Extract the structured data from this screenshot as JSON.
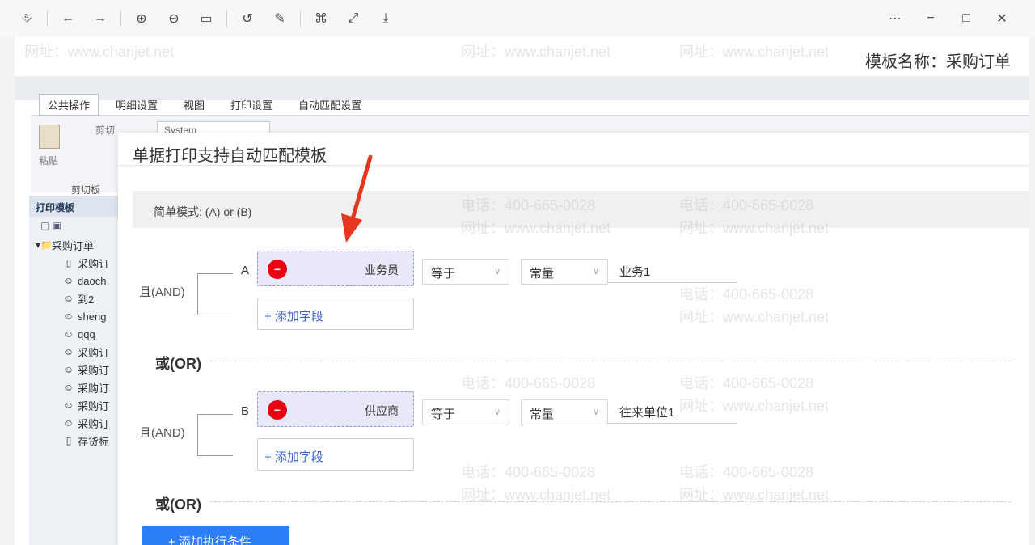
{
  "toolbar": {
    "icons": [
      "pin-icon",
      "back-icon",
      "forward-icon",
      "zoom-in-icon",
      "zoom-out-icon",
      "fit-width-icon",
      "rotate-icon",
      "draw-icon",
      "crop-icon",
      "expand-icon",
      "save-icon"
    ],
    "window_icons": [
      "more-icon",
      "minimize-icon",
      "maximize-icon",
      "close-icon"
    ]
  },
  "app": {
    "template_name": "模板名称：采购订单",
    "ribbon_tabs": [
      "公共操作",
      "明细设置",
      "视图",
      "打印设置",
      "自动匹配设置"
    ],
    "paste_label": "粘贴",
    "cut_label": "剪切",
    "font_value": "System",
    "clipboard_label": "剪切板"
  },
  "left_panel": {
    "title": "打印模板",
    "root": "采购订单",
    "items": [
      "采购订",
      "daoch",
      "到2",
      "sheng",
      "qqq",
      "采购订",
      "采购订",
      "采购订",
      "采购订",
      "采购订",
      "存货标"
    ],
    "item_icons": [
      "document-icon",
      "user-icon",
      "user-icon",
      "user-icon",
      "user-icon",
      "user-icon",
      "user-icon",
      "user-icon",
      "user-icon",
      "user-icon",
      "document-icon"
    ]
  },
  "modal": {
    "title": "单据打印支持自动匹配模板",
    "mode_text": "简单模式: (A) or (B)",
    "conditions": [
      {
        "and_label": "且(AND)",
        "letter": "A",
        "field": "业务员",
        "operator": "等于",
        "value_type": "常量",
        "value": "业务1",
        "add_field": "+ 添加字段"
      },
      {
        "and_label": "且(AND)",
        "letter": "B",
        "field": "供应商",
        "operator": "等于",
        "value_type": "常量",
        "value": "往来单位1",
        "add_field": "+ 添加字段"
      }
    ],
    "or_labels": [
      "或(OR)",
      "或(OR)"
    ],
    "add_condition": "+ 添加执行条件"
  },
  "watermark": {
    "phone": "电话：400-665-0028",
    "site": "网址：www.chanjet.net"
  },
  "colors": {
    "accent": "#2d7ff9",
    "danger": "#e60012",
    "arrow": "#e8351e",
    "chip_bg": "#e8e8f8"
  }
}
